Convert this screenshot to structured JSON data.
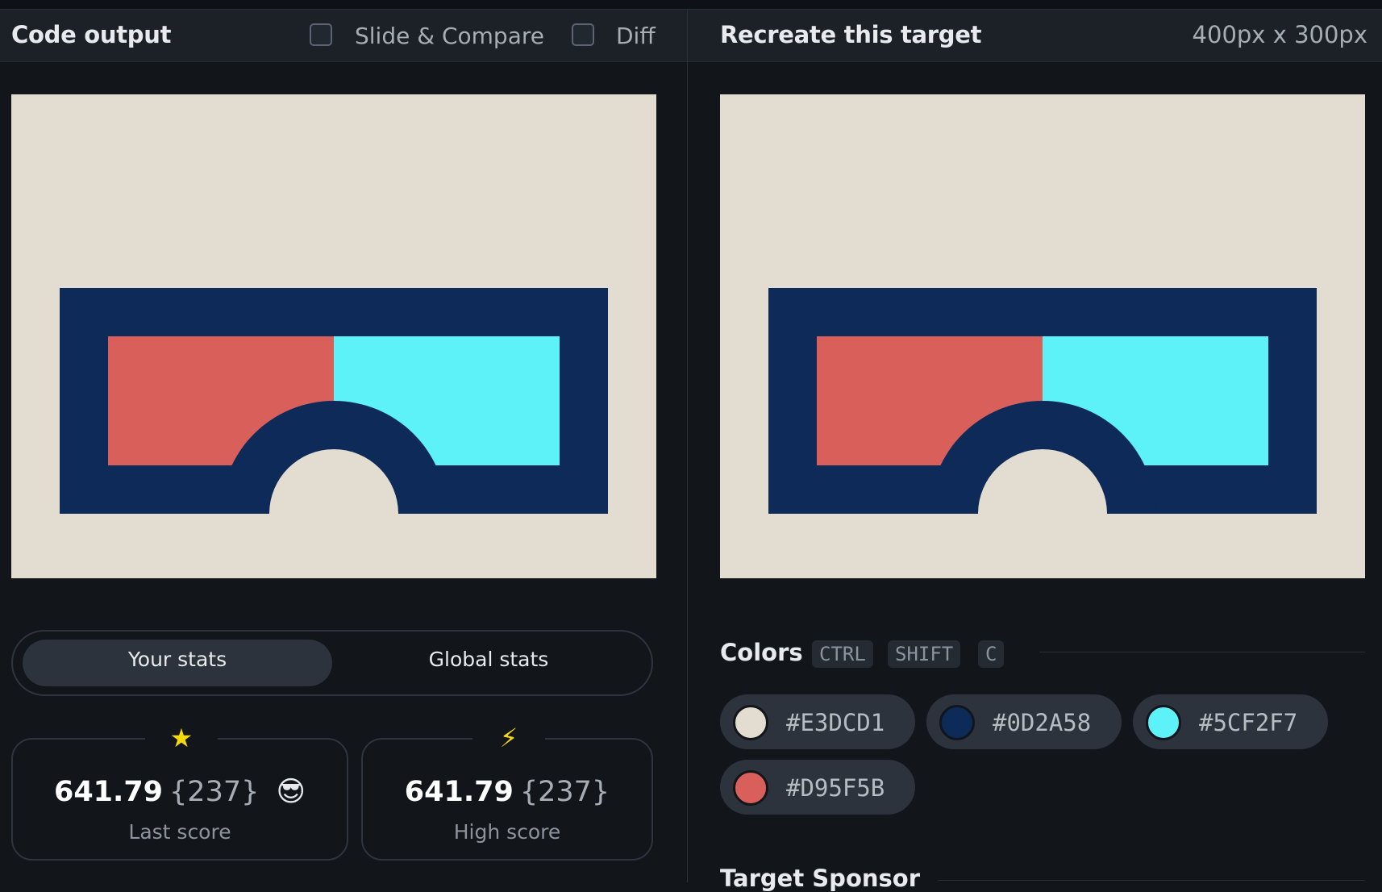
{
  "left_panel": {
    "title": "Code output",
    "slide_compare_label": "Slide & Compare",
    "diff_label": "Diff"
  },
  "right_panel": {
    "title": "Recreate this target",
    "dimensions": "400px x 300px"
  },
  "palette": {
    "background": "#E3DCD1",
    "frame": "#0D2A58",
    "left_lens": "#D95F5B",
    "right_lens": "#5CF2F7"
  },
  "stats_toggle": {
    "your_stats": "Your stats",
    "global_stats": "Global stats"
  },
  "last_score": {
    "value": "641.79",
    "count": "{237}",
    "emoji": "😎",
    "label": "Last score",
    "icon": "star-icon"
  },
  "high_score": {
    "value": "641.79",
    "count": "{237}",
    "label": "High score",
    "icon": "lightning-icon"
  },
  "colors": {
    "title": "Colors",
    "shortcut": [
      "CTRL",
      "SHIFT",
      "C"
    ],
    "swatches": [
      {
        "hex": "#E3DCD1"
      },
      {
        "hex": "#0D2A58"
      },
      {
        "hex": "#5CF2F7"
      },
      {
        "hex": "#D95F5B"
      }
    ]
  },
  "sponsor_title": "Target Sponsor"
}
